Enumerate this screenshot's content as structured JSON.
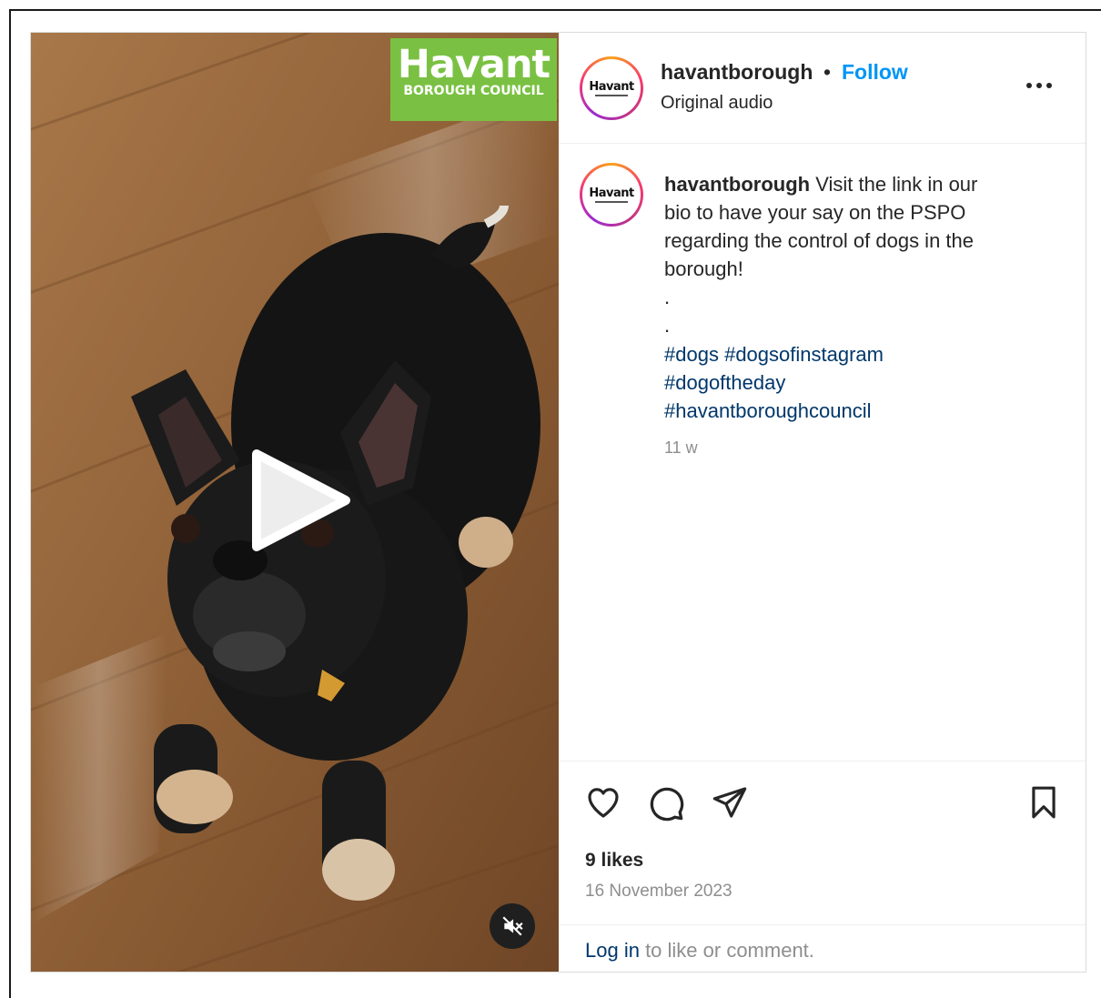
{
  "media": {
    "brand_name": "Havant",
    "brand_sub": "BOROUGH COUNCIL"
  },
  "header": {
    "username": "havantborough",
    "separator": "•",
    "follow_label": "Follow",
    "audio_label": "Original audio",
    "avatar_text": "Havant"
  },
  "caption": {
    "username": "havantborough",
    "text_line1": "Visit the link in our",
    "text_line2": "bio to have your say on the PSPO",
    "text_line3": "regarding the control of dogs in the",
    "text_line4": "borough!",
    "dot1": ".",
    "dot2": ".",
    "tags": [
      "#dogs",
      "#dogsofinstagram",
      "#dogoftheday",
      "#havantboroughcouncil"
    ],
    "age": "11 w"
  },
  "footer": {
    "likes": "9 likes",
    "date": "16 November 2023",
    "login_link": "Log in",
    "login_rest": " to like or comment."
  },
  "colors": {
    "accent": "#0095f6",
    "hashtag": "#00376b",
    "brand_green": "#7ac143"
  },
  "icons": {
    "like": "heart-icon",
    "comment": "comment-icon",
    "share": "send-icon",
    "save": "bookmark-icon",
    "more": "more-horizontal-icon",
    "play": "play-icon",
    "mute": "volume-muted-icon"
  }
}
